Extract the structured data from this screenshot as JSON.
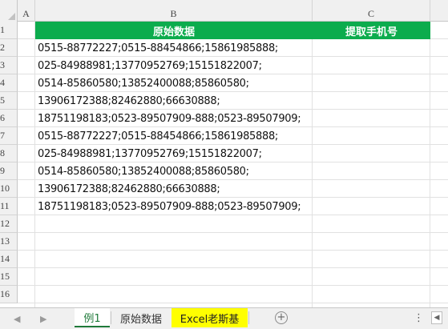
{
  "columns": [
    {
      "label": "A"
    },
    {
      "label": "B"
    },
    {
      "label": "C"
    }
  ],
  "rows": [
    "1",
    "2",
    "3",
    "4",
    "5",
    "6",
    "7",
    "8",
    "9",
    "10",
    "11",
    "12",
    "13",
    "14",
    "15",
    "16"
  ],
  "header": {
    "b1": "原始数据",
    "c1": "提取手机号",
    "fill_color": "#0cac4d"
  },
  "data_cells": [
    "0515-88772227;0515-88454866;15861985888;",
    "025-84988981;13770952769;15151822007;",
    "0514-85860580;13852400088;85860580;",
    "13906172388;82462880;66630888;",
    "18751198183;0523-89507909-888;0523-89507909;",
    "0515-88772227;0515-88454866;15861985888;",
    "025-84988981;13770952769;15151822007;",
    "0514-85860580;13852400088;85860580;",
    "13906172388;82462880;66630888;",
    "18751198183;0523-89507909-888;0523-89507909;"
  ],
  "tabs": [
    {
      "label": "例1"
    },
    {
      "label": "原始数据"
    },
    {
      "label": "Excel老斯基"
    }
  ],
  "icons": {
    "nav_prev": "◀",
    "nav_next": "▶",
    "add": "+",
    "more": "⋮",
    "scroll_left": "◀"
  },
  "colors": {
    "active_tab": "#1f7a3a",
    "highlight_tab": "#ffff00"
  }
}
